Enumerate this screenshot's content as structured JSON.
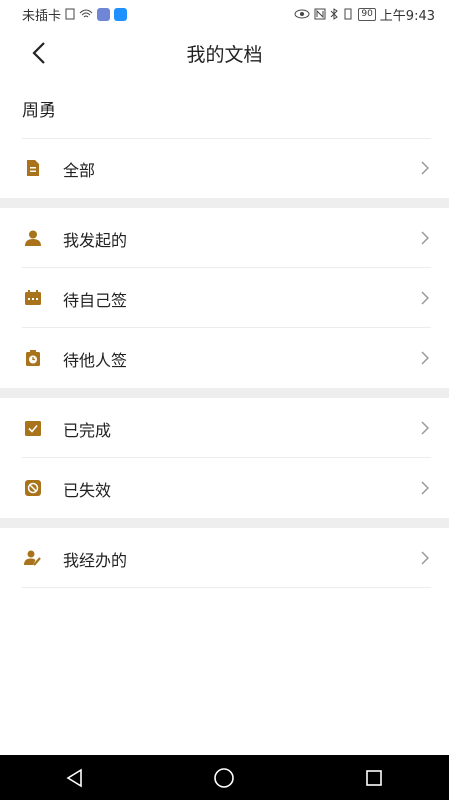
{
  "status_bar": {
    "carrier": "未插卡",
    "battery": "90",
    "time": "上午9:43",
    "colors": {
      "app1": "#6f86d6",
      "app2": "#1e90ff"
    }
  },
  "header": {
    "title": "我的文档",
    "back_icon": "chevron-left-icon"
  },
  "user": {
    "name": "周勇"
  },
  "menu": {
    "all": {
      "label": "全部",
      "icon": "document-icon"
    },
    "initiated": {
      "label": "我发起的",
      "icon": "person-icon"
    },
    "pending_self": {
      "label": "待自己签",
      "icon": "calendar-icon"
    },
    "pending_others": {
      "label": "待他人签",
      "icon": "clock-clipboard-icon"
    },
    "completed": {
      "label": "已完成",
      "icon": "check-box-icon"
    },
    "expired": {
      "label": "已失效",
      "icon": "ban-icon"
    },
    "handled": {
      "label": "我经办的",
      "icon": "person-edit-icon"
    }
  },
  "colors": {
    "accent": "#a8731a",
    "divider": "#ececec",
    "gap": "#eeeeee"
  }
}
